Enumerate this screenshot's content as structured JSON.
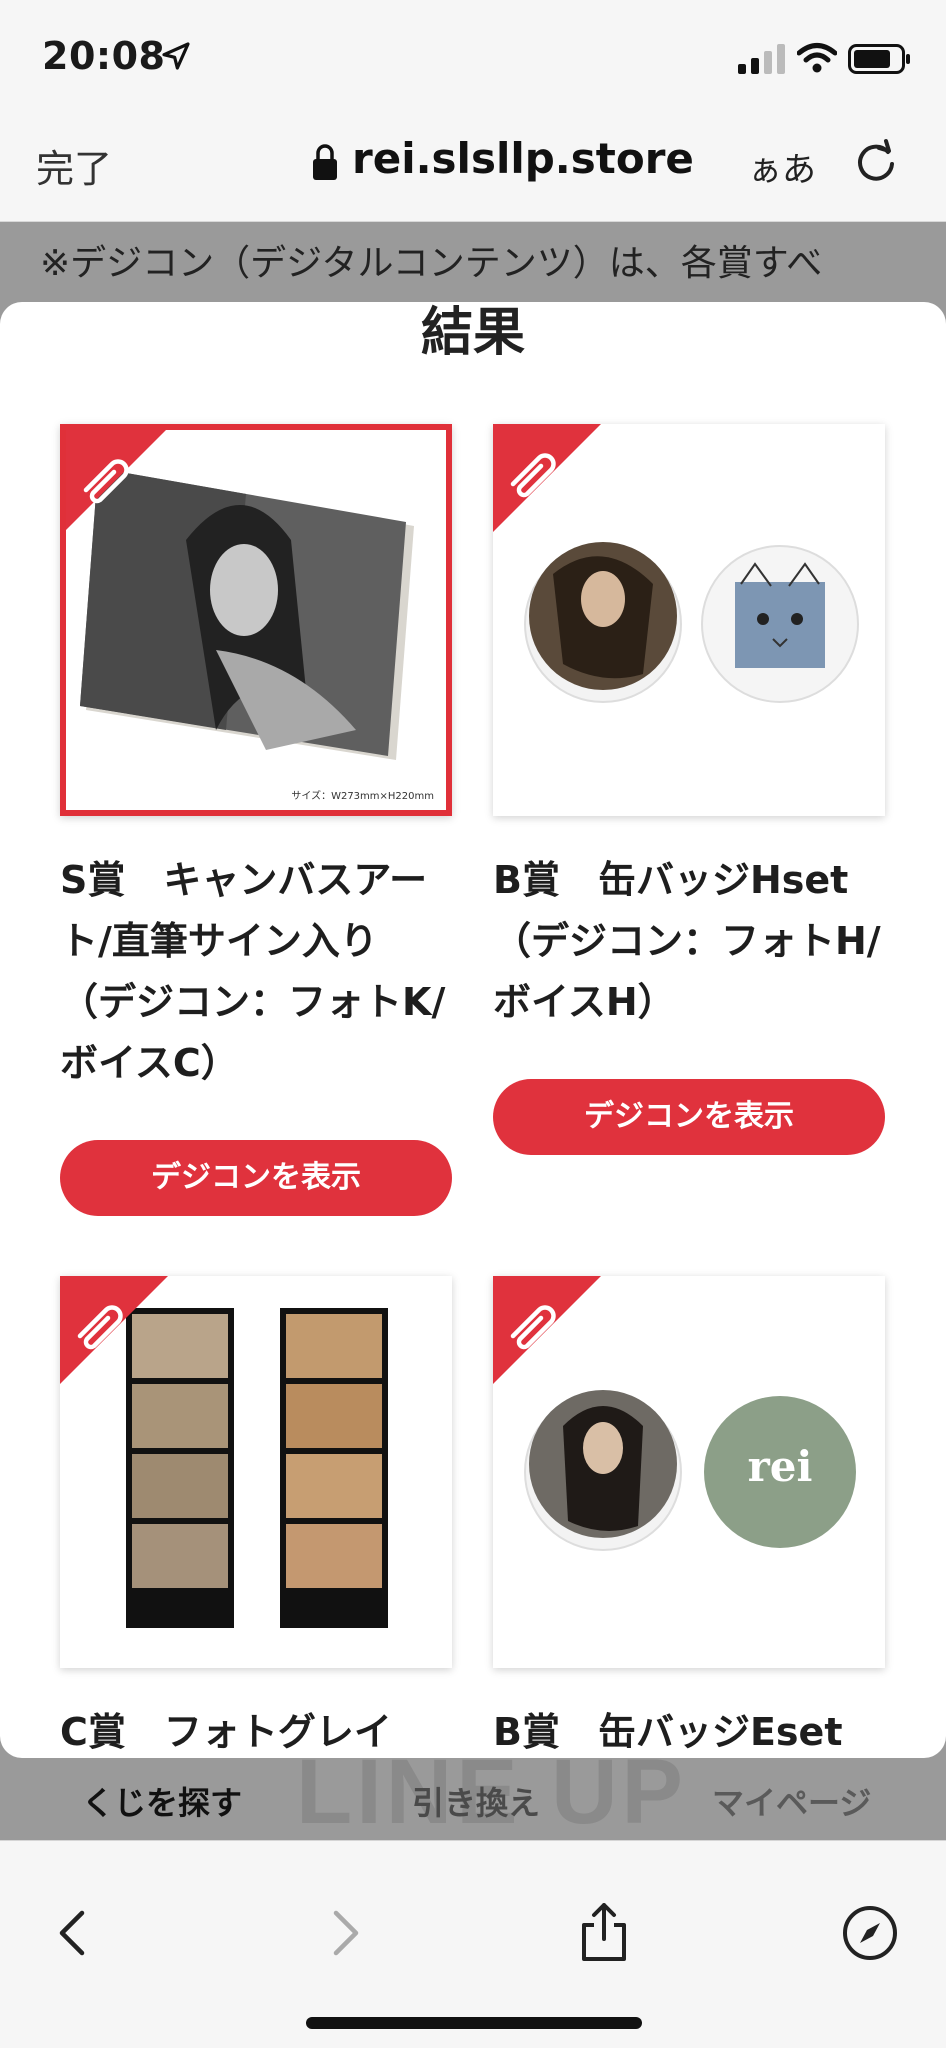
{
  "status": {
    "time": "20:08"
  },
  "browser": {
    "done_label": "完了",
    "url": "rei.slsllp.store",
    "text_size_label": "ぁあ"
  },
  "page": {
    "notice": "※デジコン（デジタルコンテンツ）は、各賞すべ",
    "logo_text": "LINE UP",
    "tabs": [
      {
        "label": "くじを探す"
      },
      {
        "label": "引き換え"
      },
      {
        "label": "マイページ"
      }
    ]
  },
  "modal": {
    "title": "結果",
    "cards": [
      {
        "title": "S賞　キャンバスアート/直筆サイン入り（デジコン：フォトK/ボイスC）",
        "button": "デジコンを表示",
        "size_caption": "サイズ：W273mm×H220mm"
      },
      {
        "title": "B賞　缶バッジHset（デジコン：フォトH/ボイスH）",
        "button": "デジコンを表示"
      },
      {
        "title": "C賞　フォトグレイ"
      },
      {
        "title": "B賞　缶バッジEset",
        "badge_text": "rei"
      }
    ]
  },
  "colors": {
    "accent": "#e0323d",
    "overlay": "#9a9a9a"
  }
}
